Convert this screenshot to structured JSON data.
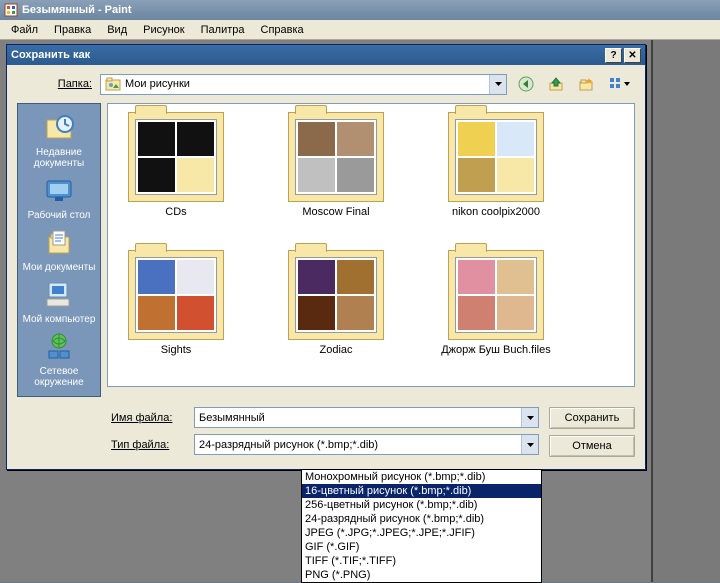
{
  "app": {
    "title": "Безымянный - Paint",
    "menu": [
      "Файл",
      "Правка",
      "Вид",
      "Рисунок",
      "Палитра",
      "Справка"
    ]
  },
  "dialog": {
    "title": "Сохранить как",
    "folder_label": "Папка:",
    "folder_value": "Мои рисунки",
    "filename_label": "Имя файла:",
    "filename_value": "Безымянный",
    "filetype_label": "Тип файла:",
    "filetype_value": "24-разрядный рисунок (*.bmp;*.dib)",
    "save_btn": "Сохранить",
    "cancel_btn": "Отмена"
  },
  "sidebar": [
    {
      "label": "Недавние документы",
      "icon": "recent"
    },
    {
      "label": "Рабочий стол",
      "icon": "desktop"
    },
    {
      "label": "Мои документы",
      "icon": "mydocs"
    },
    {
      "label": "Мой компьютер",
      "icon": "mycomputer"
    },
    {
      "label": "Сетевое окружение",
      "icon": "network"
    }
  ],
  "folders": [
    {
      "label": "CDs"
    },
    {
      "label": "Moscow Final"
    },
    {
      "label": "nikon coolpix2000"
    },
    {
      "label": "Sights"
    },
    {
      "label": "Zodiac"
    },
    {
      "label": "Джорж Буш Buch.files"
    }
  ],
  "filetype_options": [
    "Монохромный рисунок (*.bmp;*.dib)",
    "16-цветный рисунок (*.bmp;*.dib)",
    "256-цветный рисунок (*.bmp;*.dib)",
    "24-разрядный рисунок (*.bmp;*.dib)",
    "JPEG (*.JPG;*.JPEG;*.JPE;*.JFIF)",
    "GIF (*.GIF)",
    "TIFF (*.TIF;*.TIFF)",
    "PNG (*.PNG)"
  ],
  "filetype_selected_index": 1,
  "thumb_colors": {
    "0": [
      "#111",
      "#111",
      "#111",
      "#f8e8a8"
    ],
    "1": [
      "#8a6a4a",
      "#b09070",
      "#c0c0c0",
      "#9a9a9a"
    ],
    "2": [
      "#f0d050",
      "#d8e8f8",
      "#c0a050",
      "#f8e8a8"
    ],
    "3": [
      "#4a70c0",
      "#e8e8f0",
      "#c07030",
      "#d05030"
    ],
    "4": [
      "#4a2a60",
      "#a07030",
      "#5a2a10",
      "#b08050"
    ],
    "5": [
      "#e090a0",
      "#e0c090",
      "#d08070",
      "#e0b890"
    ]
  }
}
